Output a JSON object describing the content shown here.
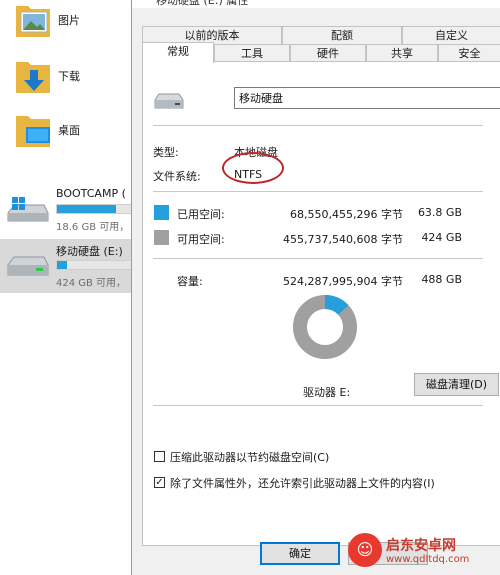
{
  "explorer": {
    "folders": [
      {
        "label": "图片",
        "icon": "pictures-folder-icon"
      },
      {
        "label": "下载",
        "icon": "downloads-folder-icon"
      },
      {
        "label": "桌面",
        "icon": "desktop-folder-icon"
      }
    ],
    "drives": [
      {
        "name": "BOOTCAMP (",
        "info": "18.6 GB 可用，",
        "used_fraction": 0.75,
        "icon": "windows-drive-icon"
      },
      {
        "name": "移动硬盘 (E:)",
        "info": "424 GB 可用，",
        "used_fraction": 0.13,
        "icon": "removable-drive-icon",
        "selected": true
      }
    ]
  },
  "dialog": {
    "title": "移动硬盘 (E:) 属性",
    "tabs_row1": [
      "以前的版本",
      "配额",
      "自定义"
    ],
    "tabs_row2": [
      "常规",
      "工具",
      "硬件",
      "共享",
      "安全"
    ],
    "active_tab": "常规",
    "drive_name_value": "移动硬盘",
    "type_label": "类型:",
    "type_value": "本地磁盘",
    "fs_label": "文件系统:",
    "fs_value": "NTFS",
    "used": {
      "label": "已用空间:",
      "bytes": "68,550,455,296 字节",
      "size": "63.8 GB",
      "color": "#26a0da"
    },
    "free": {
      "label": "可用空间:",
      "bytes": "455,737,540,608 字节",
      "size": "424 GB",
      "color": "#a0a0a0"
    },
    "capacity": {
      "label": "容量:",
      "bytes": "524,287,995,904 字节",
      "size": "488 GB"
    },
    "used_fraction": 0.131,
    "drive_label": "驱动器 E:",
    "cleanup_button": "磁盘清理(D)",
    "compress_label": "压缩此驱动器以节约磁盘空间(C)",
    "compress_checked": false,
    "index_label": "除了文件属性外，还允许索引此驱动器上文件的内容(I)",
    "index_checked": true,
    "ok_button": "确定"
  },
  "watermark": {
    "title": "启东安卓网",
    "url": "www.qdltdq.com"
  },
  "colors": {
    "accent": "#26a0da",
    "free": "#a0a0a0",
    "highlight_circle": "#c0262c"
  }
}
